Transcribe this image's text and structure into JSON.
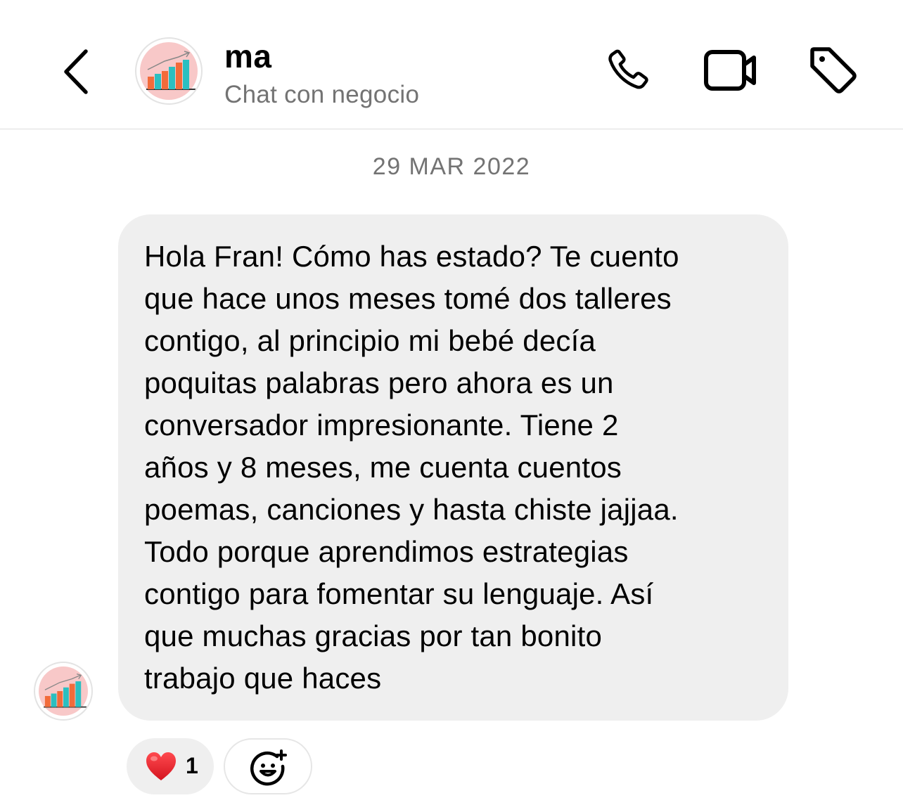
{
  "header": {
    "title": "ma",
    "subtitle": "Chat con negocio"
  },
  "date_separator": "29 MAR 2022",
  "message": {
    "lines": [
      "Hola Fran! Cómo has estado? Te cuento",
      "que hace unos meses tomé dos talleres",
      "contigo, al principio mi bebé decía",
      "poquitas palabras pero ahora es un",
      "conversador impresionante. Tiene 2",
      "años y 8 meses, me cuenta cuentos",
      "poemas, canciones y hasta chiste jajjaa.",
      "Todo porque aprendimos estrategias",
      "contigo para fomentar su lenguaje. Así",
      "que muchas gracias por tan bonito",
      "trabajo que haces"
    ]
  },
  "reaction": {
    "emoji": "heart",
    "count": "1"
  },
  "colors": {
    "bubble": "#efefef",
    "secondary_text": "#737373",
    "divider": "#dcdcdc",
    "heart": "#e0202a",
    "avatar_bg": "#f8c8c8",
    "chart_teal": "#2bbfc0",
    "chart_orange": "#f26b3a"
  },
  "icons": {
    "back": "chevron-left-icon",
    "call": "phone-icon",
    "video": "video-camera-icon",
    "tag": "tag-icon",
    "add_reaction": "add-emoji-icon"
  }
}
